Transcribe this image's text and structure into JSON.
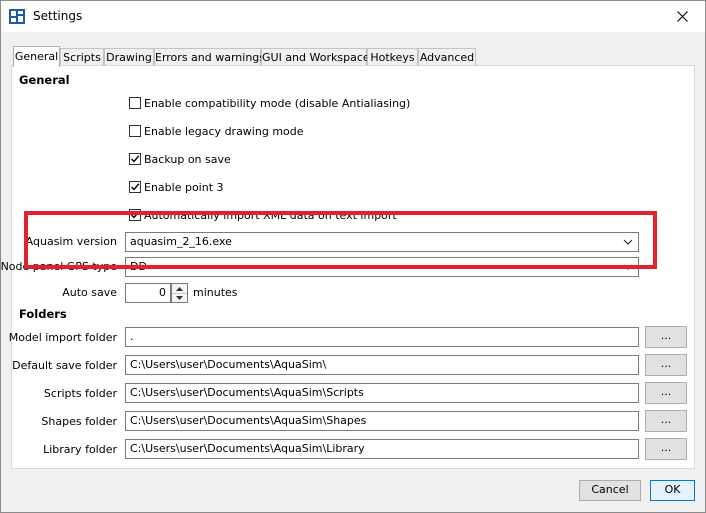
{
  "window": {
    "title": "Settings"
  },
  "tabs": [
    {
      "label": "General",
      "active": true
    },
    {
      "label": "Scripts"
    },
    {
      "label": "Drawing"
    },
    {
      "label": "Errors and warnings"
    },
    {
      "label": "GUI and Workspace"
    },
    {
      "label": "Hotkeys"
    },
    {
      "label": "Advanced"
    }
  ],
  "general": {
    "section_title": "General",
    "checkboxes": [
      {
        "label": "Enable compatibility mode (disable Antialiasing)",
        "checked": false
      },
      {
        "label": "Enable legacy drawing mode",
        "checked": false
      },
      {
        "label": "Backup on save",
        "checked": true
      },
      {
        "label": "Enable point 3",
        "checked": true
      },
      {
        "label": "Automatically import XML data on text import",
        "checked": true
      }
    ],
    "aquasim_version": {
      "label": "Aquasim version",
      "value": "aquasim_2_16.exe"
    },
    "gps_type": {
      "label": "Node panel GPS type",
      "value": "DD"
    },
    "auto_save": {
      "label": "Auto save",
      "value": "0",
      "unit": "minutes"
    }
  },
  "folders": {
    "section_title": "Folders",
    "browse_label": "...",
    "items": [
      {
        "label": "Model import folder",
        "value": "."
      },
      {
        "label": "Default save folder",
        "value": "C:\\Users\\user\\Documents\\AquaSim\\"
      },
      {
        "label": "Scripts folder",
        "value": "C:\\Users\\user\\Documents\\AquaSim\\Scripts"
      },
      {
        "label": "Shapes folder",
        "value": "C:\\Users\\user\\Documents\\AquaSim\\Shapes"
      },
      {
        "label": "Library folder",
        "value": "C:\\Users\\user\\Documents\\AquaSim\\Library"
      }
    ]
  },
  "buttons": {
    "cancel": "Cancel",
    "ok": "OK"
  },
  "colors": {
    "highlight": "#e3212a",
    "ok_border": "#0078d7"
  }
}
